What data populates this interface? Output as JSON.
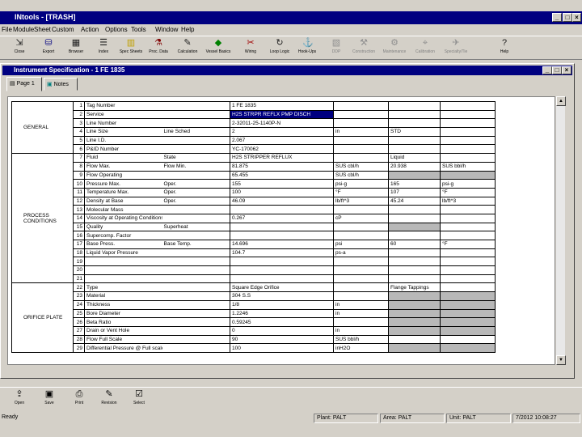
{
  "app": {
    "title": "INtools - [TRASH]"
  },
  "menu": [
    "File",
    "Module",
    "Sheet",
    "Custom",
    "Action",
    "Options",
    "Tools",
    "Window",
    "Help"
  ],
  "toolbar": [
    {
      "label": "Close",
      "icon": "close-door-icon",
      "enabled": true
    },
    {
      "label": "Export",
      "icon": "export-icon",
      "enabled": true
    },
    {
      "label": "Browser",
      "icon": "browser-icon",
      "enabled": true
    },
    {
      "label": "Index",
      "icon": "index-icon",
      "enabled": true
    },
    {
      "label": "Spec Sheets",
      "icon": "spec-sheet-icon",
      "enabled": true
    },
    {
      "label": "Proc. Data",
      "icon": "flask-icon",
      "enabled": true
    },
    {
      "label": "Calculation",
      "icon": "calculation-icon",
      "enabled": true
    },
    {
      "label": "Vessel Basics",
      "icon": "diamond-icon",
      "enabled": true
    },
    {
      "label": "Wiring",
      "icon": "wiring-icon",
      "enabled": true
    },
    {
      "label": "Loop Logic",
      "icon": "loop-icon",
      "enabled": true
    },
    {
      "label": "Hook-Ups",
      "icon": "hookup-icon",
      "enabled": true
    },
    {
      "label": "DDP",
      "icon": "ddp-icon",
      "enabled": false
    },
    {
      "label": "Construction",
      "icon": "construction-icon",
      "enabled": false
    },
    {
      "label": "Maintenance",
      "icon": "maintenance-icon",
      "enabled": false
    },
    {
      "label": "Calibration",
      "icon": "calibration-icon",
      "enabled": false
    },
    {
      "label": "Specialty/Tie",
      "icon": "specialty-icon",
      "enabled": false
    },
    {
      "label": "Help",
      "icon": "help-icon",
      "enabled": true
    }
  ],
  "spec_window": {
    "title": "Instrument Specification - 1 FE 1835"
  },
  "tabs": [
    {
      "label": "Page 1",
      "active": true
    },
    {
      "label": "Notes",
      "active": false
    }
  ],
  "sections": [
    {
      "label": "GENERAL",
      "start": 1,
      "span": 6
    },
    {
      "label": "PROCESS CONDITIONS",
      "start": 7,
      "span": 15
    },
    {
      "label": "ORIFICE PLATE",
      "start": 22,
      "span": 8
    }
  ],
  "rows": [
    {
      "n": "1",
      "label": "Tag Number",
      "label2": "",
      "v1": "1 FE 1835",
      "u1": "",
      "v2": "",
      "u2": "",
      "cls": [
        "",
        "",
        "",
        ""
      ]
    },
    {
      "n": "2",
      "label": "Service",
      "label2": "",
      "v1": "H2S STRPR REFLX PMP DISCH",
      "u1": "",
      "v2": "",
      "u2": "",
      "cls": [
        "sel",
        "",
        "",
        ""
      ]
    },
    {
      "n": "3",
      "label": "Line Number",
      "label2": "",
      "v1": "2-32011-25-1140P-N",
      "u1": "",
      "v2": "",
      "u2": "",
      "cls": [
        "",
        "",
        "",
        ""
      ]
    },
    {
      "n": "4",
      "label": "Line Size",
      "label2": "Line Sched",
      "v1": "2",
      "u1": "in",
      "v2": "STD",
      "u2": "",
      "cls": [
        "",
        "",
        "",
        ""
      ]
    },
    {
      "n": "5",
      "label": "Line I.D.",
      "label2": "",
      "v1": "2.067",
      "u1": "",
      "v2": "",
      "u2": "",
      "cls": [
        "",
        "",
        "",
        ""
      ]
    },
    {
      "n": "6",
      "label": "P&ID Number",
      "label2": "",
      "v1": "YC-170062",
      "u1": "",
      "v2": "",
      "u2": "",
      "cls": [
        "",
        "",
        "",
        ""
      ]
    },
    {
      "n": "7",
      "label": "Fluid",
      "label2": "State",
      "v1": "H2S STRIPPER REFLUX",
      "u1": "",
      "v2": "Liquid",
      "u2": "",
      "cls": [
        "",
        "",
        "",
        ""
      ]
    },
    {
      "n": "8",
      "label": "Flow Max.",
      "label2": "Flow Min.",
      "v1": "81.875",
      "u1": "SUS cbl/h",
      "v2": "20.938",
      "u2": "SUS bbl/h",
      "cls": [
        "",
        "",
        "",
        ""
      ]
    },
    {
      "n": "9",
      "label": "Flow Operating",
      "label2": "",
      "v1": "65.455",
      "u1": "SUS cbl/h",
      "v2": "",
      "u2": "",
      "cls": [
        "",
        "",
        "gs",
        "gs"
      ]
    },
    {
      "n": "10",
      "label": "Pressure Max.",
      "label2": "Oper.",
      "v1": "155",
      "u1": "psi-g",
      "v2": "165",
      "u2": "psi-g",
      "cls": [
        "",
        "",
        "",
        ""
      ]
    },
    {
      "n": "11",
      "label": "Temperature Max.",
      "label2": "Oper.",
      "v1": "100",
      "u1": "°F",
      "v2": "107",
      "u2": "°F",
      "cls": [
        "",
        "",
        "",
        ""
      ]
    },
    {
      "n": "12",
      "label": "Density at Base",
      "label2": "Oper.",
      "v1": "46.09",
      "u1": "lb/ft^3",
      "v2": "45.24",
      "u2": "lb/ft^3",
      "cls": [
        "",
        "",
        "",
        ""
      ]
    },
    {
      "n": "13",
      "label": "Molecular Mass",
      "label2": "",
      "v1": "",
      "u1": "",
      "v2": "",
      "u2": "",
      "cls": [
        "",
        "",
        "",
        ""
      ]
    },
    {
      "n": "14",
      "label": "Viscosity at Operating Conditions",
      "label2": "",
      "v1": "0.267",
      "u1": "cP",
      "v2": "",
      "u2": "",
      "cls": [
        "",
        "",
        "",
        ""
      ]
    },
    {
      "n": "15",
      "label": "Quality",
      "label2": "Superheat",
      "v1": "",
      "u1": "",
      "v2": "",
      "u2": "",
      "cls": [
        "",
        "",
        "gs",
        ""
      ]
    },
    {
      "n": "16",
      "label": "Supercomp. Factor",
      "label2": "",
      "v1": "",
      "u1": "",
      "v2": "",
      "u2": "",
      "cls": [
        "",
        "",
        "",
        ""
      ]
    },
    {
      "n": "17",
      "label": "Base Press.",
      "label2": "Base Temp.",
      "v1": "14.696",
      "u1": "psi",
      "v2": "60",
      "u2": "°F",
      "cls": [
        "",
        "",
        "",
        ""
      ]
    },
    {
      "n": "18",
      "label": "Liquid Vapor Pressure",
      "label2": "",
      "v1": "104.7",
      "u1": "ps-a",
      "v2": "",
      "u2": "",
      "cls": [
        "",
        "",
        "",
        ""
      ]
    },
    {
      "n": "19",
      "label": "",
      "label2": "",
      "v1": "",
      "u1": "",
      "v2": "",
      "u2": "",
      "cls": [
        "",
        "",
        "",
        ""
      ]
    },
    {
      "n": "20",
      "label": "",
      "label2": "",
      "v1": "",
      "u1": "",
      "v2": "",
      "u2": "",
      "cls": [
        "",
        "",
        "",
        ""
      ]
    },
    {
      "n": "21",
      "label": "",
      "label2": "",
      "v1": "",
      "u1": "",
      "v2": "",
      "u2": "",
      "cls": [
        "",
        "",
        "",
        ""
      ]
    },
    {
      "n": "22",
      "label": "Type",
      "label2": "",
      "v1": "Square Edge Orifice",
      "u1": "",
      "v2": "Flange Tappings",
      "u2": "",
      "cls": [
        "",
        "",
        "",
        ""
      ]
    },
    {
      "n": "23",
      "label": "Material",
      "label2": "",
      "v1": "304 S.S",
      "u1": "",
      "v2": "",
      "u2": "",
      "cls": [
        "",
        "",
        "gs",
        "gs"
      ]
    },
    {
      "n": "24",
      "label": "Thickness",
      "label2": "",
      "v1": "1/8",
      "u1": "in",
      "v2": "",
      "u2": "",
      "cls": [
        "",
        "",
        "gs",
        "gs"
      ]
    },
    {
      "n": "25",
      "label": "Bore Diameter",
      "label2": "",
      "v1": "1.2246",
      "u1": "in",
      "v2": "",
      "u2": "",
      "cls": [
        "",
        "",
        "gs",
        "gs"
      ]
    },
    {
      "n": "26",
      "label": "Beta Ratio",
      "label2": "",
      "v1": "0.59245",
      "u1": "",
      "v2": "",
      "u2": "",
      "cls": [
        "",
        "",
        "gs",
        "gs"
      ]
    },
    {
      "n": "27",
      "label": "Drain or Vent Hole",
      "label2": "",
      "v1": "0",
      "u1": "in",
      "v2": "",
      "u2": "",
      "cls": [
        "",
        "",
        "gs",
        "gs"
      ]
    },
    {
      "n": "28",
      "label": "Flow Full Scale",
      "label2": "",
      "v1": "90",
      "u1": "SUS bbl/h",
      "v2": "",
      "u2": "",
      "cls": [
        "",
        "",
        "",
        ""
      ]
    },
    {
      "n": "29",
      "label": "Differential Pressure @ Full scale",
      "label2": "",
      "v1": "100",
      "u1": "inH2O",
      "v2": "",
      "u2": "",
      "cls": [
        "",
        "",
        "gs",
        "gs"
      ]
    }
  ],
  "bottom_toolbar": [
    {
      "label": "Open",
      "icon": "open-icon"
    },
    {
      "label": "Save",
      "icon": "save-icon"
    },
    {
      "label": "Print",
      "icon": "print-icon"
    },
    {
      "label": "Revision",
      "icon": "revision-icon"
    },
    {
      "label": "Select",
      "icon": "select-icon"
    }
  ],
  "status": {
    "ready": "Ready",
    "plant": "Plant: PALT",
    "area": "Area: PALT",
    "unit": "Unit: PALT",
    "datetime": "7/2012 10:08:27"
  }
}
